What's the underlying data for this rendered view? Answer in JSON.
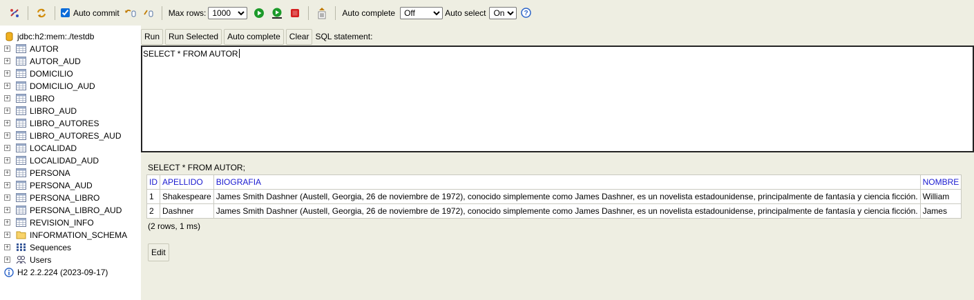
{
  "toolbar": {
    "auto_commit_label": "Auto commit",
    "auto_commit_checked": true,
    "max_rows_label": "Max rows:",
    "max_rows_value": "1000",
    "auto_complete_label": "Auto complete",
    "auto_complete_value": "Off",
    "auto_select_label": "Auto select",
    "auto_select_value": "On",
    "help_glyph": "?",
    "icons": [
      "disconnect-icon",
      "refresh-icon",
      "rollback-icon",
      "commit-icon",
      "run-icon",
      "run-selected-icon",
      "stop-icon",
      "history-icon",
      "help-icon"
    ],
    "colors": {
      "run": "#1c9a2a",
      "stop": "#d42020",
      "help": "#2a63c8"
    }
  },
  "tree": {
    "connection": "jdbc:h2:mem:./testdb",
    "tables": [
      "AUTOR",
      "AUTOR_AUD",
      "DOMICILIO",
      "DOMICILIO_AUD",
      "LIBRO",
      "LIBRO_AUD",
      "LIBRO_AUTORES",
      "LIBRO_AUTORES_AUD",
      "LOCALIDAD",
      "LOCALIDAD_AUD",
      "PERSONA",
      "PERSONA_AUD",
      "PERSONA_LIBRO",
      "PERSONA_LIBRO_AUD",
      "REVISION_INFO"
    ],
    "schema": "INFORMATION_SCHEMA",
    "sequences": "Sequences",
    "users": "Users",
    "version": "H2 2.2.224 (2023-09-17)"
  },
  "query": {
    "run_label": "Run",
    "run_selected_label": "Run Selected",
    "auto_complete_label": "Auto complete",
    "clear_label": "Clear",
    "sql_statement_label": "SQL statement:",
    "sql_text": "SELECT * FROM AUTOR"
  },
  "results": {
    "executed_sql": "SELECT * FROM AUTOR;",
    "columns": [
      "ID",
      "APELLIDO",
      "BIOGRAFIA",
      "NOMBRE"
    ],
    "rows": [
      [
        "1",
        "Shakespeare",
        "James Smith Dashner (Austell, Georgia, 26 de noviembre de 1972), conocido simplemente como James Dashner, es un novelista estadounidense, principalmente de fantasía y ciencia ficción.",
        "William"
      ],
      [
        "2",
        "Dashner",
        "James Smith Dashner (Austell, Georgia, 26 de noviembre de 1972), conocido simplemente como James Dashner, es un novelista estadounidense, principalmente de fantasía y ciencia ficción.",
        "James"
      ]
    ],
    "row_count": "(2 rows, 1 ms)",
    "edit_label": "Edit"
  }
}
